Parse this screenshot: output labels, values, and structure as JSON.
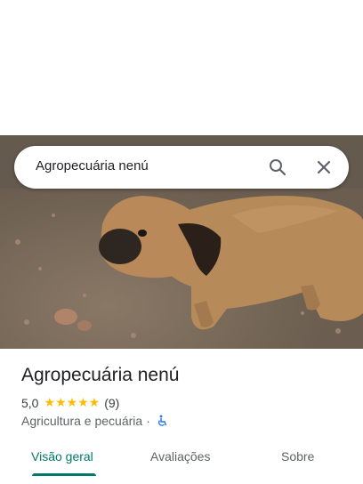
{
  "search": {
    "query": "Agropecuária nenú",
    "search_icon": "search-icon",
    "close_icon": "close-icon"
  },
  "place": {
    "name": "Agropecuária nenú",
    "rating": "5,0",
    "stars": "★★★★★",
    "reviews": "(9)",
    "category": "Agricultura e pecuária",
    "separator": "·",
    "accessibility_icon": "wheelchair-icon"
  },
  "tabs": [
    {
      "label": "Visão geral",
      "active": true
    },
    {
      "label": "Avaliações",
      "active": false
    },
    {
      "label": "Sobre",
      "active": false
    }
  ],
  "colors": {
    "accent": "#00796b",
    "star": "#fbbc04",
    "accessible": "#1a73e8"
  }
}
